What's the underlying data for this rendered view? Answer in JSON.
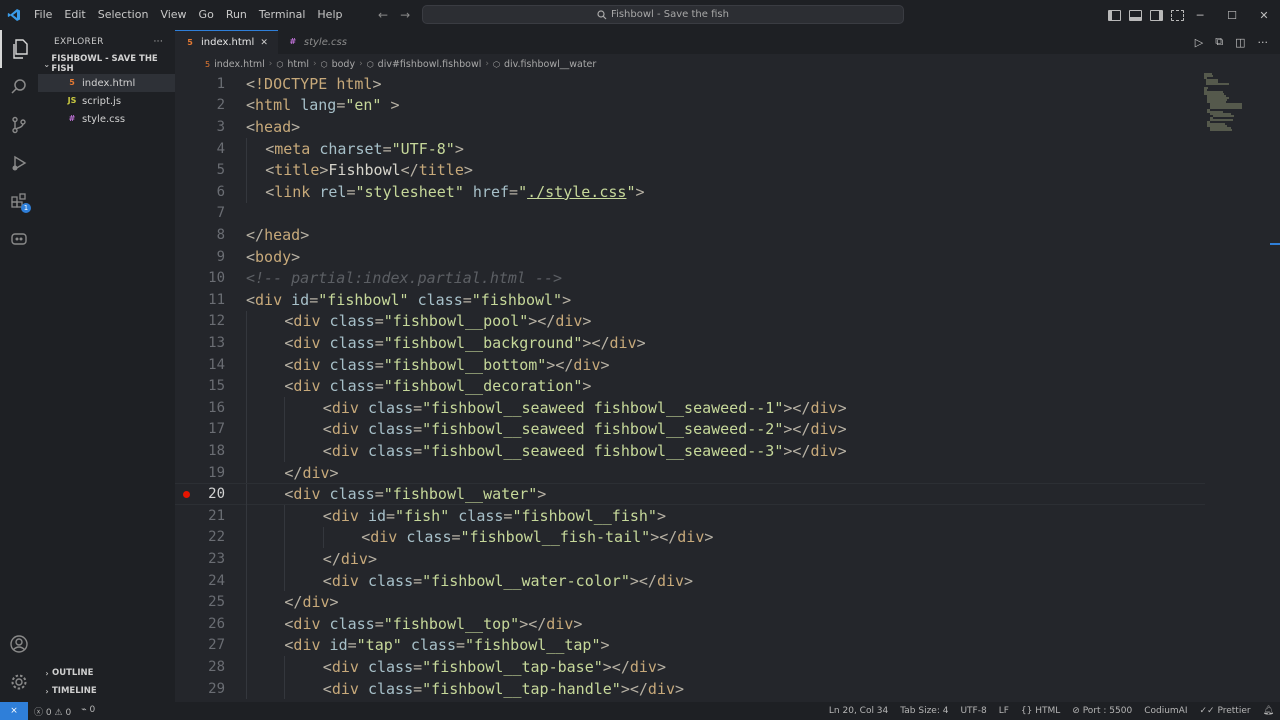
{
  "titlebar": {
    "menu": [
      "File",
      "Edit",
      "Selection",
      "View",
      "Go",
      "Run",
      "Terminal",
      "Help"
    ],
    "search_text": "Fishbowl - Save the fish"
  },
  "sidebar": {
    "title": "EXPLORER",
    "more": "···",
    "project": "FISHBOWL - SAVE THE FISH",
    "files": [
      {
        "name": "index.html",
        "icon": "html-file-icon",
        "color": "#e37933",
        "glyph": "5"
      },
      {
        "name": "script.js",
        "icon": "js-file-icon",
        "color": "#cbcb41",
        "glyph": "JS"
      },
      {
        "name": "style.css",
        "icon": "css-file-icon",
        "color": "#c072d8",
        "glyph": "#"
      }
    ],
    "outline": "OUTLINE",
    "timeline": "TIMELINE"
  },
  "activity": {
    "extensions_badge": "1"
  },
  "tabs": [
    {
      "label": "index.html",
      "close": "✕",
      "active": true
    },
    {
      "label": "style.css",
      "active": false
    }
  ],
  "breadcrumb": [
    "index.html",
    "html",
    "body",
    "div#fishbowl.fishbowl",
    "div.fishbowl__water"
  ],
  "code": {
    "current_line": 20,
    "breakpoint_line": 20,
    "lines": [
      {
        "n": "1",
        "indent": 0,
        "tokens": [
          [
            "pun",
            "<"
          ],
          [
            "tag",
            "!DOCTYPE "
          ],
          [
            "tag",
            "html"
          ],
          [
            "pun",
            ">"
          ]
        ]
      },
      {
        "n": "2",
        "indent": 0,
        "tokens": [
          [
            "pun",
            "<"
          ],
          [
            "tag",
            "html "
          ],
          [
            "attr",
            "lang"
          ],
          [
            "pun",
            "="
          ],
          [
            "str",
            "\"en\""
          ],
          [
            "pun",
            " >"
          ]
        ]
      },
      {
        "n": "3",
        "indent": 0,
        "tokens": [
          [
            "pun",
            "<"
          ],
          [
            "tag",
            "head"
          ],
          [
            "pun",
            ">"
          ]
        ]
      },
      {
        "n": "4",
        "indent": 1,
        "tokens": [
          [
            "pun",
            "<"
          ],
          [
            "tag",
            "meta "
          ],
          [
            "attr",
            "charset"
          ],
          [
            "pun",
            "="
          ],
          [
            "str",
            "\"UTF-8\""
          ],
          [
            "pun",
            ">"
          ]
        ]
      },
      {
        "n": "5",
        "indent": 1,
        "tokens": [
          [
            "pun",
            "<"
          ],
          [
            "tag",
            "title"
          ],
          [
            "pun",
            ">"
          ],
          [
            "txt",
            "Fishbowl"
          ],
          [
            "pun",
            "</"
          ],
          [
            "tag",
            "title"
          ],
          [
            "pun",
            ">"
          ]
        ]
      },
      {
        "n": "6",
        "indent": 1,
        "tokens": [
          [
            "pun",
            "<"
          ],
          [
            "tag",
            "link "
          ],
          [
            "attr",
            "rel"
          ],
          [
            "pun",
            "="
          ],
          [
            "str",
            "\"stylesheet\" "
          ],
          [
            "attr",
            "href"
          ],
          [
            "pun",
            "="
          ],
          [
            "str",
            "\""
          ],
          [
            "strlink",
            "./style.css"
          ],
          [
            "str",
            "\""
          ],
          [
            "pun",
            ">"
          ]
        ]
      },
      {
        "n": "7",
        "indent": 0,
        "tokens": []
      },
      {
        "n": "8",
        "indent": 0,
        "tokens": [
          [
            "pun",
            "</"
          ],
          [
            "tag",
            "head"
          ],
          [
            "pun",
            ">"
          ]
        ]
      },
      {
        "n": "9",
        "indent": 0,
        "tokens": [
          [
            "pun",
            "<"
          ],
          [
            "tag",
            "body"
          ],
          [
            "pun",
            ">"
          ]
        ]
      },
      {
        "n": "10",
        "indent": 0,
        "tokens": [
          [
            "com",
            "<!-- partial:index.partial.html -->"
          ]
        ]
      },
      {
        "n": "11",
        "indent": 0,
        "tokens": [
          [
            "pun",
            "<"
          ],
          [
            "tag",
            "div "
          ],
          [
            "attr",
            "id"
          ],
          [
            "pun",
            "="
          ],
          [
            "str",
            "\"fishbowl\" "
          ],
          [
            "attr",
            "class"
          ],
          [
            "pun",
            "="
          ],
          [
            "str",
            "\"fishbowl\""
          ],
          [
            "pun",
            ">"
          ]
        ]
      },
      {
        "n": "12",
        "indent": 2,
        "tokens": [
          [
            "pun",
            "<"
          ],
          [
            "tag",
            "div "
          ],
          [
            "attr",
            "class"
          ],
          [
            "pun",
            "="
          ],
          [
            "str",
            "\"fishbowl__pool\""
          ],
          [
            "pun",
            "></"
          ],
          [
            "tag",
            "div"
          ],
          [
            "pun",
            ">"
          ]
        ]
      },
      {
        "n": "13",
        "indent": 2,
        "tokens": [
          [
            "pun",
            "<"
          ],
          [
            "tag",
            "div "
          ],
          [
            "attr",
            "class"
          ],
          [
            "pun",
            "="
          ],
          [
            "str",
            "\"fishbowl__background\""
          ],
          [
            "pun",
            "></"
          ],
          [
            "tag",
            "div"
          ],
          [
            "pun",
            ">"
          ]
        ]
      },
      {
        "n": "14",
        "indent": 2,
        "tokens": [
          [
            "pun",
            "<"
          ],
          [
            "tag",
            "div "
          ],
          [
            "attr",
            "class"
          ],
          [
            "pun",
            "="
          ],
          [
            "str",
            "\"fishbowl__bottom\""
          ],
          [
            "pun",
            "></"
          ],
          [
            "tag",
            "div"
          ],
          [
            "pun",
            ">"
          ]
        ]
      },
      {
        "n": "15",
        "indent": 2,
        "tokens": [
          [
            "pun",
            "<"
          ],
          [
            "tag",
            "div "
          ],
          [
            "attr",
            "class"
          ],
          [
            "pun",
            "="
          ],
          [
            "str",
            "\"fishbowl__decoration\""
          ],
          [
            "pun",
            ">"
          ]
        ]
      },
      {
        "n": "16",
        "indent": 4,
        "tokens": [
          [
            "pun",
            "<"
          ],
          [
            "tag",
            "div "
          ],
          [
            "attr",
            "class"
          ],
          [
            "pun",
            "="
          ],
          [
            "str",
            "\"fishbowl__seaweed fishbowl__seaweed--1\""
          ],
          [
            "pun",
            "></"
          ],
          [
            "tag",
            "div"
          ],
          [
            "pun",
            ">"
          ]
        ]
      },
      {
        "n": "17",
        "indent": 4,
        "tokens": [
          [
            "pun",
            "<"
          ],
          [
            "tag",
            "div "
          ],
          [
            "attr",
            "class"
          ],
          [
            "pun",
            "="
          ],
          [
            "str",
            "\"fishbowl__seaweed fishbowl__seaweed--2\""
          ],
          [
            "pun",
            "></"
          ],
          [
            "tag",
            "div"
          ],
          [
            "pun",
            ">"
          ]
        ]
      },
      {
        "n": "18",
        "indent": 4,
        "tokens": [
          [
            "pun",
            "<"
          ],
          [
            "tag",
            "div "
          ],
          [
            "attr",
            "class"
          ],
          [
            "pun",
            "="
          ],
          [
            "str",
            "\"fishbowl__seaweed fishbowl__seaweed--3\""
          ],
          [
            "pun",
            "></"
          ],
          [
            "tag",
            "div"
          ],
          [
            "pun",
            ">"
          ]
        ]
      },
      {
        "n": "19",
        "indent": 2,
        "tokens": [
          [
            "pun",
            "</"
          ],
          [
            "tag",
            "div"
          ],
          [
            "pun",
            ">"
          ]
        ]
      },
      {
        "n": "20",
        "indent": 2,
        "tokens": [
          [
            "pun",
            "<"
          ],
          [
            "tag",
            "div "
          ],
          [
            "attr",
            "class"
          ],
          [
            "pun",
            "="
          ],
          [
            "str",
            "\"fishbowl__water\""
          ],
          [
            "pun",
            ">"
          ]
        ]
      },
      {
        "n": "21",
        "indent": 4,
        "tokens": [
          [
            "pun",
            "<"
          ],
          [
            "tag",
            "div "
          ],
          [
            "attr",
            "id"
          ],
          [
            "pun",
            "="
          ],
          [
            "str",
            "\"fish\" "
          ],
          [
            "attr",
            "class"
          ],
          [
            "pun",
            "="
          ],
          [
            "str",
            "\"fishbowl__fish\""
          ],
          [
            "pun",
            ">"
          ]
        ]
      },
      {
        "n": "22",
        "indent": 6,
        "tokens": [
          [
            "pun",
            "<"
          ],
          [
            "tag",
            "div "
          ],
          [
            "attr",
            "class"
          ],
          [
            "pun",
            "="
          ],
          [
            "str",
            "\"fishbowl__fish-tail\""
          ],
          [
            "pun",
            "></"
          ],
          [
            "tag",
            "div"
          ],
          [
            "pun",
            ">"
          ]
        ]
      },
      {
        "n": "23",
        "indent": 4,
        "tokens": [
          [
            "pun",
            "</"
          ],
          [
            "tag",
            "div"
          ],
          [
            "pun",
            ">"
          ]
        ]
      },
      {
        "n": "24",
        "indent": 4,
        "tokens": [
          [
            "pun",
            "<"
          ],
          [
            "tag",
            "div "
          ],
          [
            "attr",
            "class"
          ],
          [
            "pun",
            "="
          ],
          [
            "str",
            "\"fishbowl__water-color\""
          ],
          [
            "pun",
            "></"
          ],
          [
            "tag",
            "div"
          ],
          [
            "pun",
            ">"
          ]
        ]
      },
      {
        "n": "25",
        "indent": 2,
        "tokens": [
          [
            "pun",
            "</"
          ],
          [
            "tag",
            "div"
          ],
          [
            "pun",
            ">"
          ]
        ]
      },
      {
        "n": "26",
        "indent": 2,
        "tokens": [
          [
            "pun",
            "<"
          ],
          [
            "tag",
            "div "
          ],
          [
            "attr",
            "class"
          ],
          [
            "pun",
            "="
          ],
          [
            "str",
            "\"fishbowl__top\""
          ],
          [
            "pun",
            "></"
          ],
          [
            "tag",
            "div"
          ],
          [
            "pun",
            ">"
          ]
        ]
      },
      {
        "n": "27",
        "indent": 2,
        "tokens": [
          [
            "pun",
            "<"
          ],
          [
            "tag",
            "div "
          ],
          [
            "attr",
            "id"
          ],
          [
            "pun",
            "="
          ],
          [
            "str",
            "\"tap\" "
          ],
          [
            "attr",
            "class"
          ],
          [
            "pun",
            "="
          ],
          [
            "str",
            "\"fishbowl__tap\""
          ],
          [
            "pun",
            ">"
          ]
        ]
      },
      {
        "n": "28",
        "indent": 4,
        "tokens": [
          [
            "pun",
            "<"
          ],
          [
            "tag",
            "div "
          ],
          [
            "attr",
            "class"
          ],
          [
            "pun",
            "="
          ],
          [
            "str",
            "\"fishbowl__tap-base\""
          ],
          [
            "pun",
            "></"
          ],
          [
            "tag",
            "div"
          ],
          [
            "pun",
            ">"
          ]
        ]
      },
      {
        "n": "29",
        "indent": 4,
        "tokens": [
          [
            "pun",
            "<"
          ],
          [
            "tag",
            "div "
          ],
          [
            "attr",
            "class"
          ],
          [
            "pun",
            "="
          ],
          [
            "str",
            "\"fishbowl__tap-handle\""
          ],
          [
            "pun",
            "></"
          ],
          [
            "tag",
            "div"
          ],
          [
            "pun",
            ">"
          ]
        ]
      }
    ]
  },
  "statusbar": {
    "remote": "⨯",
    "errors": "0",
    "warnings": "0",
    "ports": "0",
    "position": "Ln 20, Col 34",
    "tab_size": "Tab Size: 4",
    "encoding": "UTF-8",
    "eol": "LF",
    "language": "HTML",
    "port": "Port : 5500",
    "codium": "CodiumAI",
    "prettier": "Prettier"
  }
}
